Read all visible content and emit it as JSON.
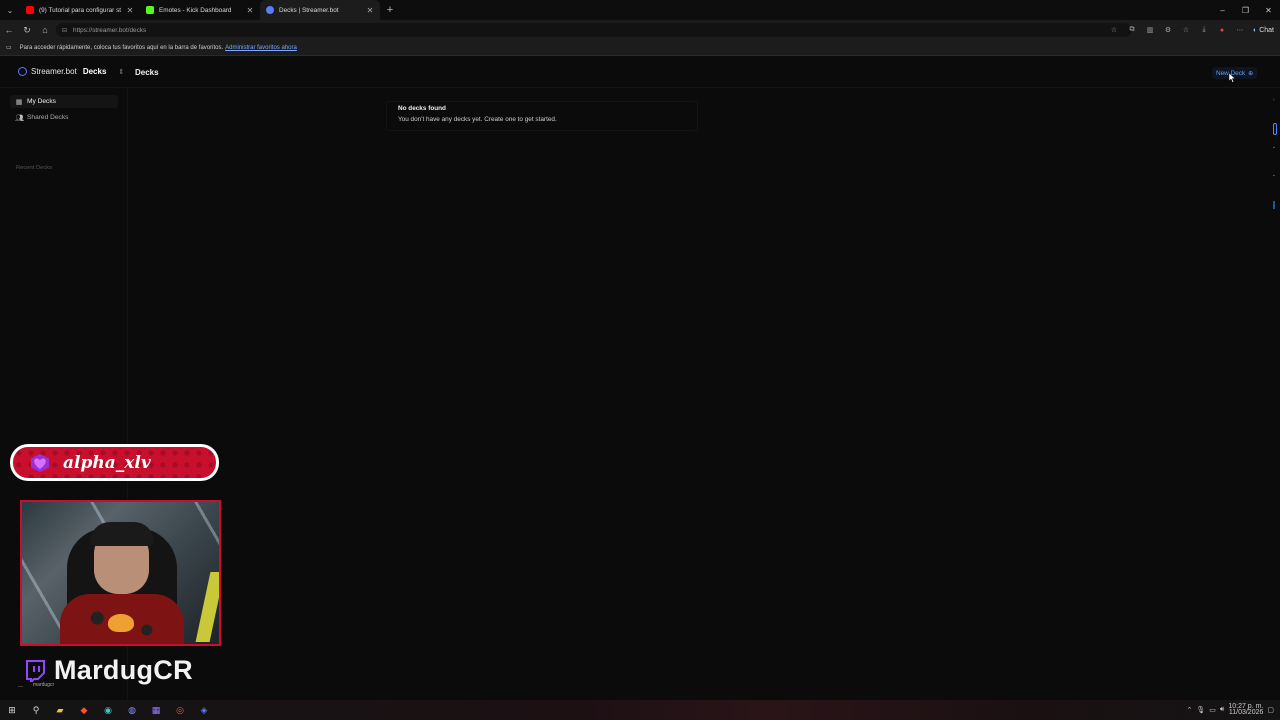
{
  "browser": {
    "tabs": [
      {
        "title": "(9) Tutorial para configurar strea",
        "favicon_color": "#ff0000"
      },
      {
        "title": "Emotes - Kick Dashboard",
        "favicon_color": "#53fc18"
      },
      {
        "title": "Decks | Streamer.bot",
        "favicon_color": "#5b7cff"
      }
    ],
    "new_tab_label": "+",
    "url": "https://streamer.bot/decks",
    "chat_label": "Chat",
    "bookmarks_prompt": "Para acceder rápidamente, coloca tus favoritos aquí en la barra de favoritos.",
    "bookmarks_link": "Administrar favoritos ahora"
  },
  "app": {
    "brand_name": "Streamer.bot",
    "brand_section": "Decks",
    "page_title": "Decks",
    "new_deck_label": "New Deck",
    "sidebar": {
      "items": [
        {
          "label": "My Decks",
          "icon": "grid-icon",
          "active": true
        },
        {
          "label": "Shared Decks",
          "icon": "users-icon",
          "active": false
        }
      ],
      "recent_label": "Recent Decks"
    },
    "empty_state": {
      "title": "No decks found",
      "message": "You don't have any decks yet. Create one to get started."
    },
    "accent_color": "#5ea3ff"
  },
  "overlay": {
    "banner_username": "alpha_xlv",
    "banner_color": "#c8102e",
    "streamer_name": "MardugCR",
    "streamer_sub": "mardugcr"
  },
  "taskbar": {
    "time": "10:27 p. m.",
    "date": "11/03/2026"
  }
}
